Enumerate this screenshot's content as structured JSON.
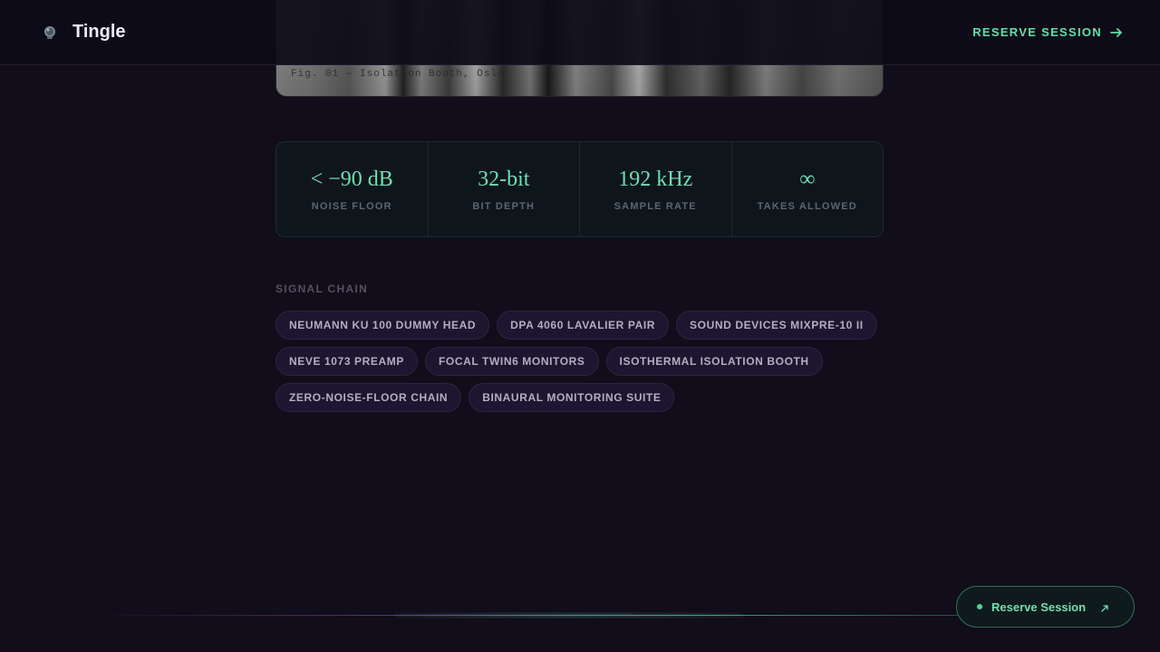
{
  "header": {
    "brand_name": "Tingle",
    "brand_icon": "microphone-icon",
    "cta_label": "RESERVE SESSION",
    "cta_icon": "arrow-right-icon"
  },
  "photo": {
    "caption": "Fig. 01 — Isolation Booth, Oslo"
  },
  "stats": [
    {
      "value": "< −90 dB",
      "label": "NOISE FLOOR"
    },
    {
      "value": "32-bit",
      "label": "BIT DEPTH"
    },
    {
      "value": "192 kHz",
      "label": "SAMPLE RATE"
    },
    {
      "value": "∞",
      "label": "TAKES ALLOWED"
    }
  ],
  "signal_chain": {
    "title": "SIGNAL CHAIN",
    "items": [
      "NEUMANN KU 100 DUMMY HEAD",
      "DPA 4060 LAVALIER PAIR",
      "SOUND DEVICES MIXPRE-10 II",
      "NEVE 1073 PREAMP",
      "FOCAL TWIN6 MONITORS",
      "ISOTHERMAL ISOLATION BOOTH",
      "ZERO-NOISE-FLOOR CHAIN",
      "BINAURAL MONITORING SUITE"
    ]
  },
  "floating_button": {
    "label": "Reserve Session",
    "icon": "arrow-up-right-icon"
  },
  "colors": {
    "background": "#110d1a",
    "accent": "#5fe0a6",
    "chip_bg": "#1e1530"
  }
}
